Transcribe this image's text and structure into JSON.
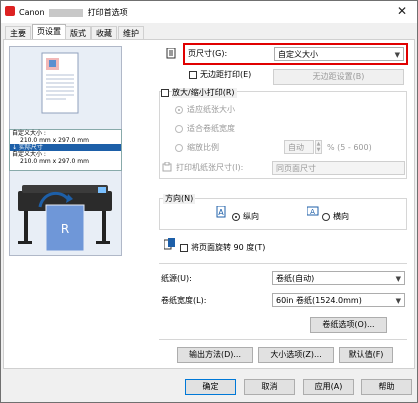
{
  "window": {
    "title_prefix": "Canon",
    "title_suffix": "打印首选项",
    "close_glyph": "✕"
  },
  "tabs": [
    "主要",
    "页设置",
    "版式",
    "收藏",
    "维护"
  ],
  "active_tab": "页设置",
  "preview": {
    "lines": [
      "自定义大小 :",
      "210.0 mm x 297.0 mm",
      "↓ 实际尺寸",
      "自定义大小 :",
      "210.0 mm x 297.0 mm"
    ]
  },
  "page_size": {
    "label": "页尺寸(G):",
    "value": "自定义大小"
  },
  "borderless": {
    "label": "无边距打印(E)",
    "button": "无边距设置(B)"
  },
  "scaling": {
    "label": "放大/缩小打印(R)",
    "fit_page": "适应纸张大小",
    "fit_roll": "适合卷纸宽度",
    "zoom_label": "缩放比例",
    "zoom_mode": "自动",
    "zoom_suffix": "% (5 - 600)",
    "print_area_label": "打印机纸张尺寸(I):",
    "print_area_value": "同页面尺寸"
  },
  "orientation": {
    "label": "方向(N)",
    "portrait": "纵向",
    "landscape": "横向"
  },
  "rotate": {
    "label": "将页面旋转 90 度(T)"
  },
  "paper_source": {
    "label": "纸源(U):",
    "value": "卷纸(自动)"
  },
  "roll_width": {
    "label": "卷纸宽度(L):",
    "value": "60in 卷纸(1524.0mm)"
  },
  "roll_options_button": "卷纸选项(O)...",
  "output_method_button": "输出方法(D)...",
  "size_options_button": "大小选项(Z)...",
  "defaults_button": "默认值(F)",
  "footer": {
    "ok": "确定",
    "cancel": "取消",
    "apply": "应用(A)",
    "help": "帮助"
  }
}
